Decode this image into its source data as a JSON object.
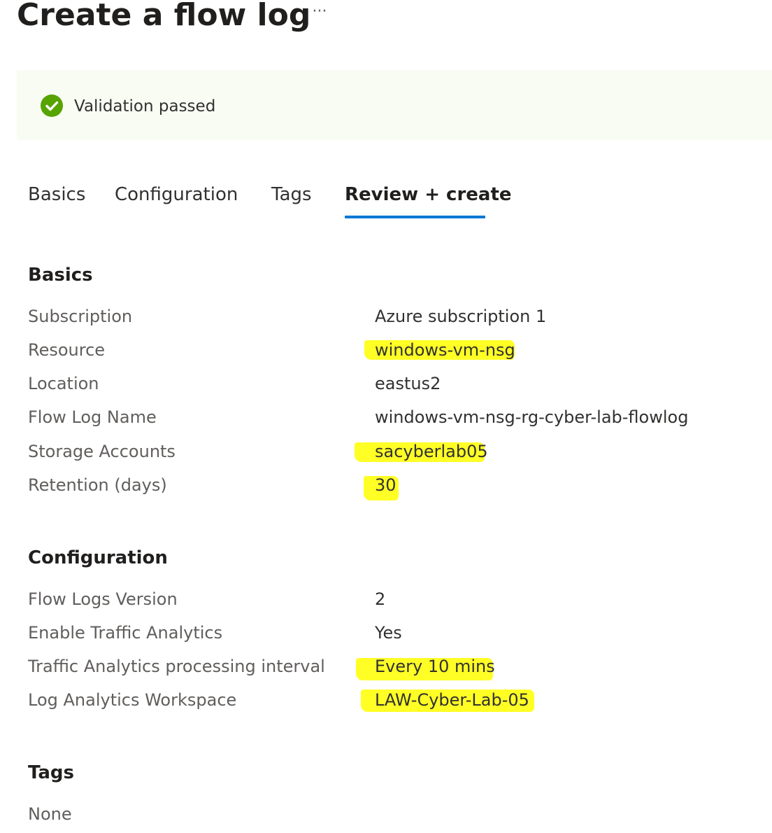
{
  "header": {
    "title": "Create a flow log",
    "more_label": "···"
  },
  "banner": {
    "icon": "check-circle-icon",
    "message": "Validation passed",
    "colors": {
      "background": "#f8fcf3",
      "icon": "#57a300"
    }
  },
  "tabs": [
    {
      "label": "Basics",
      "active": false
    },
    {
      "label": "Configuration",
      "active": false
    },
    {
      "label": "Tags",
      "active": false
    },
    {
      "label": "Review + create",
      "active": true
    }
  ],
  "accent_color": "#0078d4",
  "highlight_color": "#ffff00",
  "sections": {
    "basics": {
      "title": "Basics",
      "rows": [
        {
          "label": "Subscription",
          "value": "Azure subscription 1",
          "highlighted": false
        },
        {
          "label": "Resource",
          "value": "windows-vm-nsg",
          "highlighted": true
        },
        {
          "label": "Location",
          "value": "eastus2",
          "highlighted": false
        },
        {
          "label": "Flow Log Name",
          "value": "windows-vm-nsg-rg-cyber-lab-flowlog",
          "highlighted": false
        },
        {
          "label": "Storage Accounts",
          "value": "sacyberlab05",
          "highlighted": true
        },
        {
          "label": "Retention (days)",
          "value": "30",
          "highlighted": true
        }
      ]
    },
    "configuration": {
      "title": "Configuration",
      "rows": [
        {
          "label": "Flow Logs Version",
          "value": "2",
          "highlighted": false
        },
        {
          "label": "Enable Traffic Analytics",
          "value": "Yes",
          "highlighted": false
        },
        {
          "label": "Traffic Analytics processing interval",
          "value": "Every 10 mins",
          "highlighted": true
        },
        {
          "label": "Log Analytics Workspace",
          "value": "LAW-Cyber-Lab-05",
          "highlighted": true
        }
      ]
    },
    "tags": {
      "title": "Tags",
      "value": "None"
    }
  }
}
